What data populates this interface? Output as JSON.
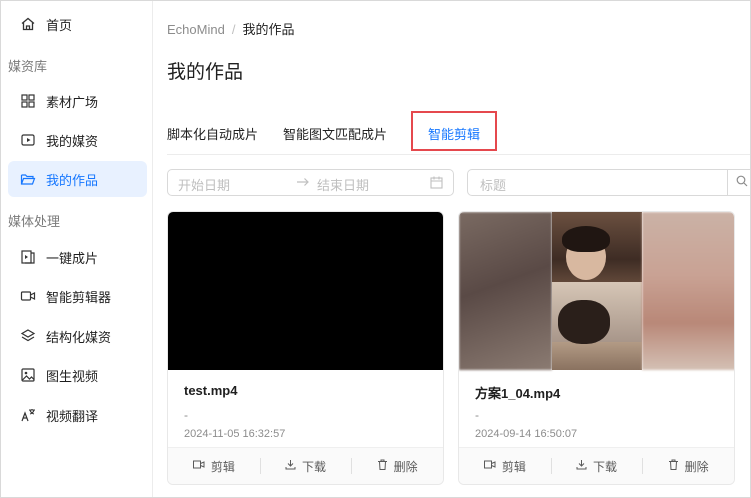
{
  "sidebar": {
    "items": [
      {
        "label": "首页",
        "icon": "home-icon"
      },
      {
        "label": "素材广场",
        "icon": "grid-icon"
      },
      {
        "label": "我的媒资",
        "icon": "media-icon"
      },
      {
        "label": "我的作品",
        "icon": "folder-open-icon",
        "active": true
      },
      {
        "label": "一键成片",
        "icon": "clip-icon"
      },
      {
        "label": "智能剪辑器",
        "icon": "video-camera-icon"
      },
      {
        "label": "结构化媒资",
        "icon": "layers-icon"
      },
      {
        "label": "图生视频",
        "icon": "image-icon"
      },
      {
        "label": "视频翻译",
        "icon": "translate-icon"
      }
    ],
    "groups": [
      "媒资库",
      "媒体处理"
    ]
  },
  "breadcrumb": {
    "root": "EchoMind",
    "sep": "/",
    "current": "我的作品"
  },
  "page_title": "我的作品",
  "tabs": [
    {
      "label": "脚本化自动成片"
    },
    {
      "label": "智能图文匹配成片"
    },
    {
      "label": "智能剪辑",
      "active": true
    }
  ],
  "filters": {
    "start_placeholder": "开始日期",
    "end_placeholder": "结束日期",
    "title_placeholder": "标题"
  },
  "cards": [
    {
      "name": "test.mp4",
      "desc": "-",
      "date": "2024-11-05 16:32:57"
    },
    {
      "name": "方案1_04.mp4",
      "desc": "-",
      "date": "2024-09-14 16:50:07"
    }
  ],
  "card_actions": {
    "edit": "剪辑",
    "download": "下载",
    "delete": "删除"
  },
  "colors": {
    "accent": "#1677ff",
    "active_bg": "#e8f1ff",
    "highlight": "#e5484d"
  }
}
